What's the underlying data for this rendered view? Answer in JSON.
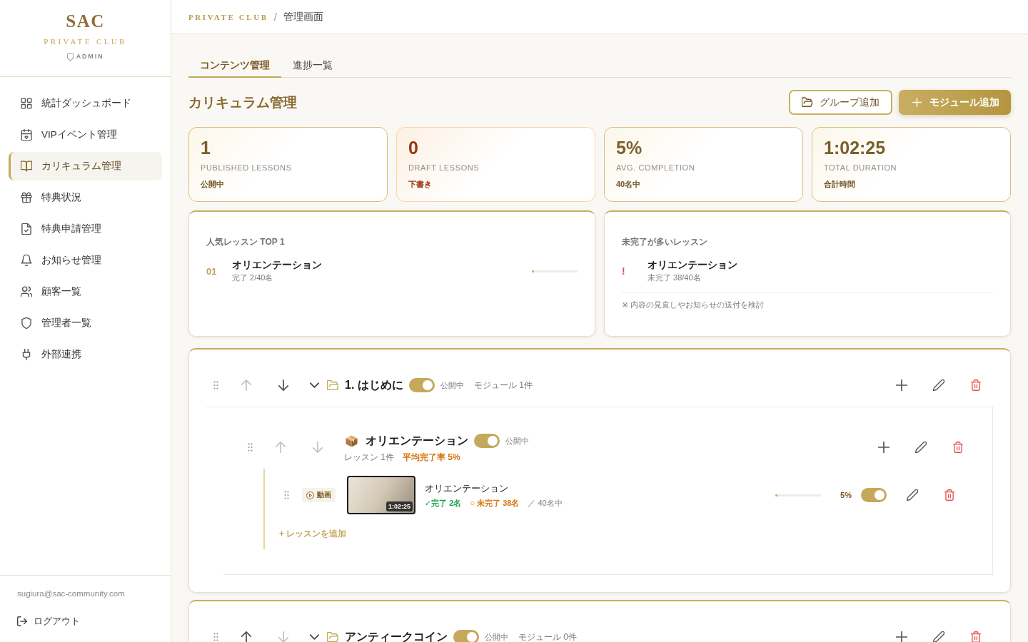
{
  "sidebar": {
    "logo": {
      "title": "SAC",
      "subtitle": "PRIVATE CLUB",
      "role": "ADMIN"
    },
    "items": [
      {
        "label": "統計ダッシュボード",
        "selected": false
      },
      {
        "label": "VIPイベント管理",
        "selected": false
      },
      {
        "label": "カリキュラム管理",
        "selected": true
      },
      {
        "label": "特典状況",
        "selected": false
      },
      {
        "label": "特典申請管理",
        "selected": false
      },
      {
        "label": "お知らせ管理",
        "selected": false
      },
      {
        "label": "顧客一覧",
        "selected": false
      },
      {
        "label": "管理者一覧",
        "selected": false
      },
      {
        "label": "外部連携",
        "selected": false
      }
    ],
    "user_email": "sugiura@sac-community.com",
    "logout": "ログアウト"
  },
  "breadcrumb": {
    "brand": "PRIVATE CLUB",
    "separator": "/",
    "page": "管理画面"
  },
  "tabs": [
    {
      "label": "コンテンツ管理",
      "selected": true
    },
    {
      "label": "進捗一覧",
      "selected": false
    }
  ],
  "title": "カリキュラム管理",
  "actions": [
    {
      "label": "グループ追加",
      "kind": "outline"
    },
    {
      "label": "モジュール追加",
      "kind": "primary"
    }
  ],
  "stats": [
    {
      "value": "1",
      "label": "PUBLISHED LESSONS",
      "note": "公開中",
      "kind": "normal"
    },
    {
      "value": "0",
      "label": "DRAFT LESSONS",
      "note": "下書き",
      "kind": "draft"
    },
    {
      "value": "5%",
      "label": "AVG. COMPLETION",
      "note": "40名中",
      "kind": "normal"
    },
    {
      "value": "1:02:25",
      "label": "TOTAL DURATION",
      "note": "合計時間",
      "kind": "normal"
    }
  ],
  "popular": {
    "title": "人気レッスン TOP 1",
    "items": [
      {
        "rank": "01",
        "name": "オリエンテーション",
        "detail": "完了 2/40名",
        "level": 0.05
      }
    ]
  },
  "incomplete": {
    "title": "未完了が多いレッスン",
    "items": [
      {
        "mark": "!",
        "name": "オリエンテーション",
        "detail": "未完了 38/40名"
      }
    ],
    "note": "※ 内容の見直しやお知らせの送付を検討"
  },
  "groups": [
    {
      "title": "1. はじめに",
      "up_disabled": true,
      "down_disabled": false,
      "expanded": true,
      "published": true,
      "status": "公開中",
      "count": "モジュール 1件",
      "modules": [
        {
          "title": "オリエンテーション",
          "up_disabled": true,
          "down_disabled": true,
          "published": true,
          "status": "公開中",
          "lesson_count": "レッスン 1件",
          "average": "平均完了率 5%",
          "lessons": [
            {
              "type_label": "動画",
              "duration": "1:02:25",
              "title": "オリエンテーション",
              "completed": "✓完了 2名",
              "pending": "○ 未完了 38名",
              "total": "／ 40名中",
              "level": 0.05,
              "percent": "5%",
              "published": true
            }
          ],
          "add_lesson": "+ レッスンを追加"
        }
      ]
    },
    {
      "title": "アンティークコイン",
      "up_disabled": false,
      "down_disabled": true,
      "expanded": true,
      "published": true,
      "status": "公開中",
      "count": "モジュール 0件"
    }
  ]
}
